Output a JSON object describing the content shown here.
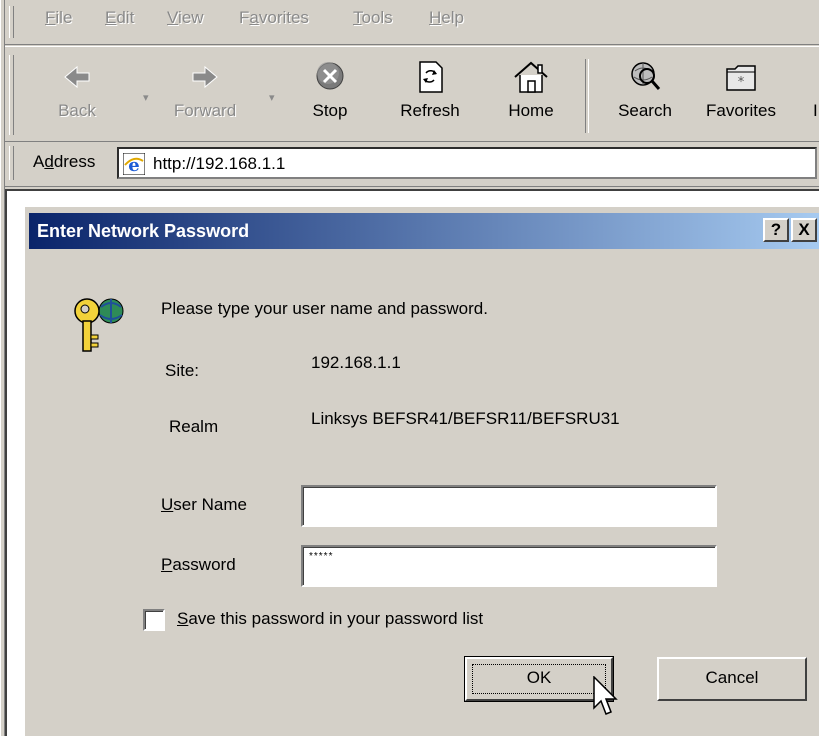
{
  "menubar": {
    "items": [
      {
        "prefix": "",
        "key": "F",
        "rest": "ile"
      },
      {
        "prefix": "",
        "key": "E",
        "rest": "dit"
      },
      {
        "prefix": "",
        "key": "V",
        "rest": "iew"
      },
      {
        "prefix": "F",
        "key": "a",
        "rest": "vorites"
      },
      {
        "prefix": "",
        "key": "T",
        "rest": "ools"
      },
      {
        "prefix": "",
        "key": "H",
        "rest": "elp"
      }
    ]
  },
  "toolbar": {
    "back": "Back",
    "forward": "Forward",
    "stop": "Stop",
    "refresh": "Refresh",
    "home": "Home",
    "search": "Search",
    "favorites": "Favorites"
  },
  "addressbar": {
    "label_prefix": "A",
    "label_key": "d",
    "label_rest": "dress",
    "url": "http://192.168.1.1"
  },
  "dialog": {
    "title": "Enter Network Password",
    "help_button": "?",
    "close_button": "X",
    "prompt": "Please type your user name and password.",
    "site_label": "Site:",
    "site_value": "192.168.1.1",
    "realm_label": "Realm",
    "realm_value": "Linksys BEFSR41/BEFSR11/BEFSRU31",
    "username_label_key": "U",
    "username_label_rest": "ser Name",
    "username_value": "",
    "password_label_key": "P",
    "password_label_rest": "assword",
    "password_value": "*****",
    "save_key": "S",
    "save_rest": "ave this password in your password list",
    "save_checked": false,
    "ok": "OK",
    "cancel": "Cancel"
  }
}
